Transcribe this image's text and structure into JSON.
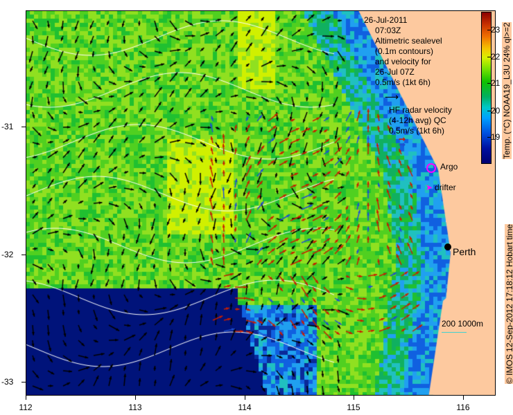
{
  "legend": {
    "date": "26-Jul-2011",
    "time": "07:03Z",
    "altimetry_lines": [
      "Altimetric sealevel",
      "(0.1m contours)",
      "and velocity for",
      "26-Jul 07Z",
      "0.5m/s (1kt 6h)"
    ],
    "hf_lines": [
      "HF radar velocity",
      "(4-12h avg) QC",
      "0.5m/s (1kt 6h)"
    ],
    "argo": "Argo",
    "drifter": "drifter",
    "city": "Perth",
    "depth_scale": "200  1000m"
  },
  "colorbar": {
    "title": "Temp. (°C) NOAA19_L3U 24% ql>=2",
    "ticks": [
      "23",
      "22",
      "21",
      "20",
      "19"
    ],
    "range": [
      18.3,
      23.5
    ]
  },
  "axes": {
    "x_ticks": [
      "112",
      "113",
      "114",
      "115",
      "116"
    ],
    "y_ticks": [
      "-31",
      "-32",
      "-33"
    ]
  },
  "credit": "© IMOS 12-Sep-2012 17:18:12 Hobart time",
  "colors": {
    "land": "#fdc99f",
    "radar_red": "#c81e00",
    "radar_blue": "#1e50d0",
    "argo": "#ff00ff"
  }
}
